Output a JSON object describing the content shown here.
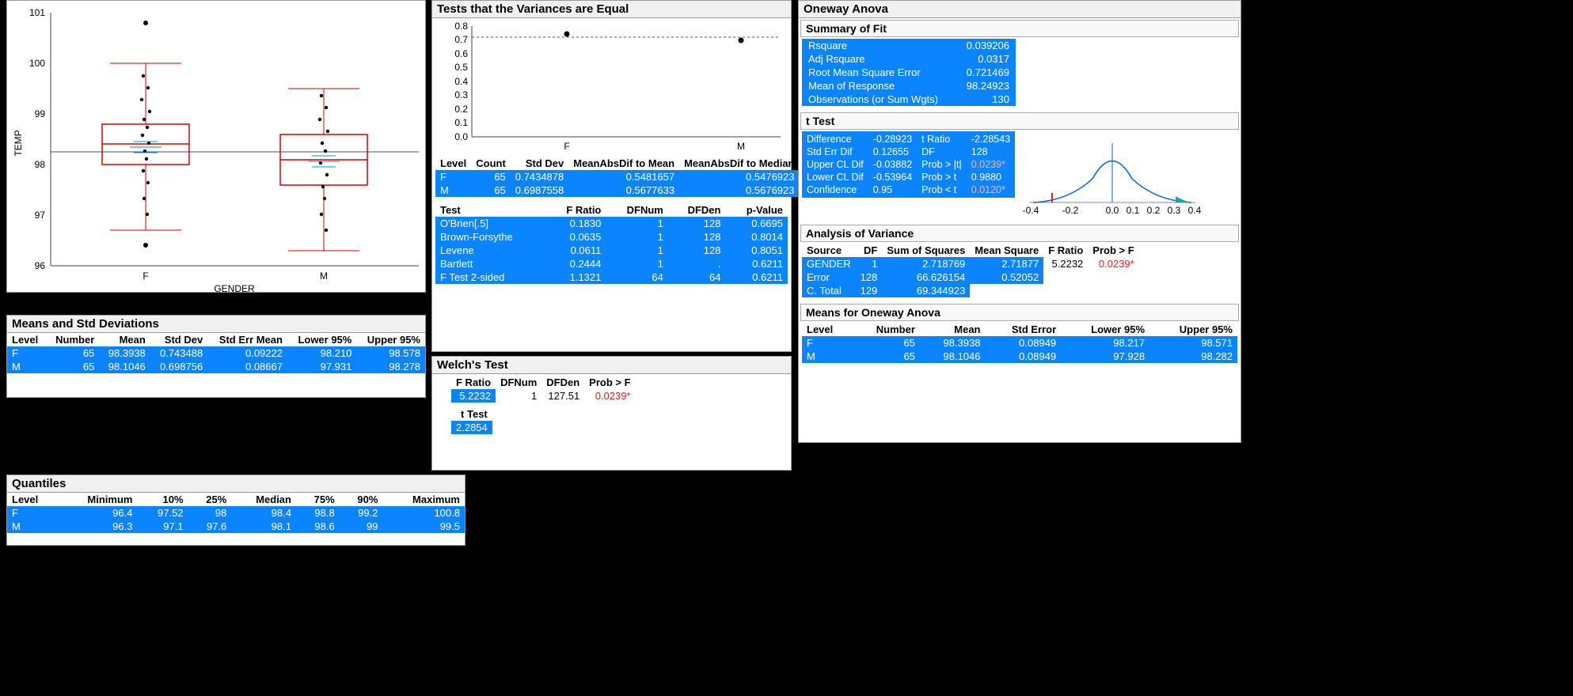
{
  "boxplot": {
    "ylabel": "TEMP",
    "xlabel": "GENDER",
    "categories": [
      "F",
      "M"
    ],
    "yticks": [
      96,
      97,
      98,
      99,
      100,
      101
    ]
  },
  "chart_data": [
    {
      "type": "boxplot",
      "title": "",
      "xlabel": "GENDER",
      "ylabel": "TEMP",
      "ylim": [
        96,
        101
      ],
      "categories": [
        "F",
        "M"
      ],
      "series": [
        {
          "name": "F",
          "min": 96.4,
          "q1": 98.0,
          "median": 98.4,
          "q3": 98.8,
          "max": 100.8,
          "whisker_low": 96.7,
          "whisker_high": 100.0,
          "outliers": [
            96.4,
            100.8
          ]
        },
        {
          "name": "M",
          "min": 96.3,
          "q1": 97.6,
          "median": 98.1,
          "q3": 98.6,
          "max": 99.5,
          "whisker_low": 96.3,
          "whisker_high": 99.5,
          "outliers": []
        }
      ],
      "grand_mean": 98.24923
    },
    {
      "type": "scatter",
      "title": "Tests that the Variances are Equal",
      "xlabel": "",
      "ylabel": "",
      "ylim": [
        0.0,
        0.8
      ],
      "yticks": [
        0.0,
        0.1,
        0.2,
        0.3,
        0.4,
        0.5,
        0.6,
        0.7,
        0.8
      ],
      "categories": [
        "F",
        "M"
      ],
      "values": [
        0.7434878,
        0.6987558
      ],
      "reference_line": 0.72
    }
  ],
  "means_sd": {
    "title": "Means and Std Deviations",
    "headers": [
      "Level",
      "Number",
      "Mean",
      "Std Dev",
      "Std Err Mean",
      "Lower 95%",
      "Upper 95%"
    ],
    "rows": [
      [
        "F",
        "65",
        "98.3938",
        "0.743488",
        "0.09222",
        "98.210",
        "98.578"
      ],
      [
        "M",
        "65",
        "98.1046",
        "0.698756",
        "0.08667",
        "97.931",
        "98.278"
      ]
    ]
  },
  "quantiles": {
    "title": "Quantiles",
    "headers": [
      "Level",
      "Minimum",
      "10%",
      "25%",
      "Median",
      "75%",
      "90%",
      "Maximum"
    ],
    "rows": [
      [
        "F",
        "96.4",
        "97.52",
        "98",
        "98.4",
        "98.8",
        "99.2",
        "100.8"
      ],
      [
        "M",
        "96.3",
        "97.1",
        "97.6",
        "98.1",
        "98.6",
        "99",
        "99.5"
      ]
    ]
  },
  "vartest": {
    "title": "Tests that the Variances are Equal",
    "level_table": {
      "headers": [
        "Level",
        "Count",
        "Std Dev",
        "MeanAbsDif to Mean",
        "MeanAbsDif to Median"
      ],
      "rows": [
        [
          "F",
          "65",
          "0.7434878",
          "0.5481657",
          "0.5476923"
        ],
        [
          "M",
          "65",
          "0.6987558",
          "0.5677633",
          "0.5676923"
        ]
      ]
    },
    "test_table": {
      "headers": [
        "Test",
        "F Ratio",
        "DFNum",
        "DFDen",
        "p-Value"
      ],
      "rows": [
        [
          "O'Brien[.5]",
          "0.1830",
          "1",
          "128",
          "0.6695"
        ],
        [
          "Brown-Forsythe",
          "0.0635",
          "1",
          "128",
          "0.8014"
        ],
        [
          "Levene",
          "0.0611",
          "1",
          "128",
          "0.8051"
        ],
        [
          "Bartlett",
          "0.2444",
          "1",
          ".",
          "0.6211"
        ],
        [
          "F Test 2-sided",
          "1.1321",
          "64",
          "64",
          "0.6211"
        ]
      ]
    }
  },
  "welch": {
    "title": "Welch's Test",
    "headers": [
      "F Ratio",
      "DFNum",
      "DFDen",
      "Prob > F"
    ],
    "row": [
      "5.2232",
      "1",
      "127.51",
      "0.0239*"
    ],
    "ttest_label": "t Test",
    "ttest_value": "2.2854"
  },
  "anova": {
    "title": "Oneway Anova",
    "summary": {
      "title": "Summary of Fit",
      "rows": [
        [
          "Rsquare",
          "0.039206"
        ],
        [
          "Adj Rsquare",
          "0.0317"
        ],
        [
          "Root Mean Square Error",
          "0.721469"
        ],
        [
          "Mean of Response",
          "98.24923"
        ],
        [
          "Observations (or Sum Wgts)",
          "130"
        ]
      ]
    },
    "ttest": {
      "title": "t Test",
      "left_rows": [
        [
          "Difference",
          "-0.28923"
        ],
        [
          "Std Err Dif",
          "0.12655"
        ],
        [
          "Upper CL Dif",
          "-0.03882"
        ],
        [
          "Lower CL Dif",
          "-0.53964"
        ],
        [
          "Confidence",
          "0.95"
        ]
      ],
      "right_rows": [
        [
          "t Ratio",
          "-2.28543"
        ],
        [
          "DF",
          "128"
        ],
        [
          "Prob > |t|",
          "0.0239*"
        ],
        [
          "Prob > t",
          "0.9880"
        ],
        [
          "Prob < t",
          "0.0120*"
        ]
      ],
      "curve_xticks": [
        "-0.4",
        "-0.2",
        "0.0",
        "0.1",
        "0.2",
        "0.3",
        "0.4"
      ]
    },
    "aov": {
      "title": "Analysis of Variance",
      "headers": [
        "Source",
        "DF",
        "Sum of Squares",
        "Mean Square",
        "F Ratio",
        "Prob > F"
      ],
      "rows": [
        [
          "GENDER",
          "1",
          "2.718769",
          "2.71877",
          "5.2232",
          "0.0239*"
        ],
        [
          "Error",
          "128",
          "66.626154",
          "0.52052",
          "",
          ""
        ],
        [
          "C. Total",
          "129",
          "69.344923",
          "",
          "",
          ""
        ]
      ]
    },
    "means": {
      "title": "Means for Oneway Anova",
      "headers": [
        "Level",
        "Number",
        "Mean",
        "Std Error",
        "Lower 95%",
        "Upper 95%"
      ],
      "rows": [
        [
          "F",
          "65",
          "98.3938",
          "0.08949",
          "98.217",
          "98.571"
        ],
        [
          "M",
          "65",
          "98.1046",
          "0.08949",
          "97.928",
          "98.282"
        ]
      ]
    }
  }
}
